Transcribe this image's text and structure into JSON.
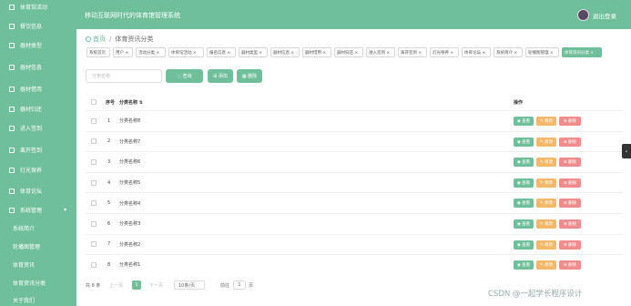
{
  "header": {
    "title": "移动互联网时代的体育馆管理系统",
    "logout": "退出登录"
  },
  "sidebar": {
    "items": [
      {
        "label": "体育馆活动"
      },
      {
        "label": "餐饮信息"
      },
      {
        "label": "器材类型"
      },
      {
        "label": "器材信息"
      },
      {
        "label": "器材借用"
      },
      {
        "label": "器材归还"
      },
      {
        "label": "进入签到"
      },
      {
        "label": "离开签到"
      },
      {
        "label": "灯光保养"
      },
      {
        "label": "体育论坛"
      },
      {
        "label": "系统管理",
        "caret": "▾"
      }
    ],
    "subitems": [
      {
        "label": "系统简介"
      },
      {
        "label": "轮播图管理"
      },
      {
        "label": "体育资讯"
      },
      {
        "label": "体育资讯分类"
      },
      {
        "label": "关于我们"
      }
    ]
  },
  "breadcrumb": {
    "home": "首页",
    "sep": "/",
    "current": "体育资讯分类"
  },
  "tabs": [
    {
      "label": "系统首页"
    },
    {
      "label": "用户 ×"
    },
    {
      "label": "活动分类 ×"
    },
    {
      "label": "体育馆活动 ×"
    },
    {
      "label": "报名信息 ×"
    },
    {
      "label": "器材类型 ×"
    },
    {
      "label": "器材信息 ×"
    },
    {
      "label": "器材借用 ×"
    },
    {
      "label": "器材归还 ×"
    },
    {
      "label": "进入签到 ×"
    },
    {
      "label": "离开签到 ×"
    },
    {
      "label": "灯光保养 ×"
    },
    {
      "label": "体育论坛 ×"
    },
    {
      "label": "系统简介 ×"
    },
    {
      "label": "轮播图管理 ×"
    },
    {
      "label": "体育资讯分类 ×"
    }
  ],
  "toolbar": {
    "search_placeholder": "分类名称",
    "query": "◌ 查询",
    "add": "⊞ 添加",
    "delete": "▦ 删除"
  },
  "table": {
    "headers": {
      "index": "序号",
      "name": "分类名称 ⇅",
      "ops": "操作"
    },
    "rows": [
      {
        "index": "1",
        "name": "分类名称8"
      },
      {
        "index": "2",
        "name": "分类名称7"
      },
      {
        "index": "3",
        "name": "分类名称6"
      },
      {
        "index": "4",
        "name": "分类名称5"
      },
      {
        "index": "5",
        "name": "分类名称4"
      },
      {
        "index": "6",
        "name": "分类名称3"
      },
      {
        "index": "7",
        "name": "分类名称2"
      },
      {
        "index": "8",
        "name": "分类名称1"
      }
    ],
    "actions": {
      "view": "◉ 查看",
      "edit": "✎ 修改",
      "delete": "⊗ 删除"
    }
  },
  "pagination": {
    "total": "共 8 条",
    "prev": "上一页",
    "page": "1",
    "next": "下一页",
    "page_size": "10条/页",
    "goto": "前往",
    "goto_page": "1",
    "page_unit": "页"
  },
  "watermark": "CSDN @一起学长程序设计",
  "colors": {
    "primary": "#6fbf9a",
    "edit": "#f3b86a",
    "delete": "#f18c8c"
  }
}
